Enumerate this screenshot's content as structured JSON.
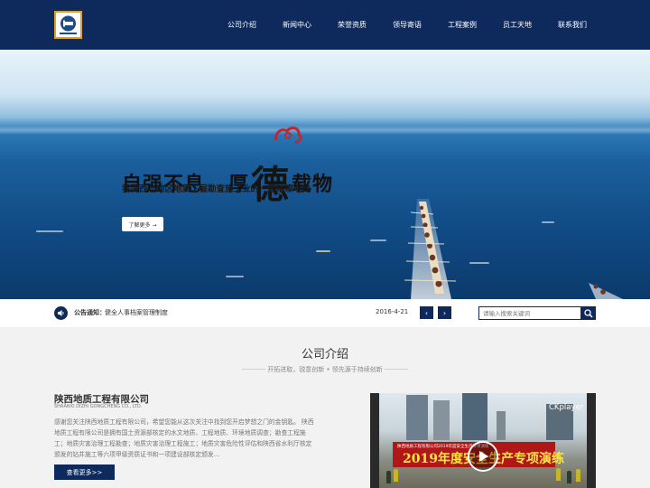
{
  "header": {
    "nav": [
      "公司介绍",
      "新闻中心",
      "荣誉资质",
      "领导寄语",
      "工程案例",
      "员工天地",
      "联系我们"
    ]
  },
  "banner": {
    "title_left": "自强不息",
    "title_mid_a": "厚",
    "title_big": "德",
    "title_right": "载物",
    "subtitle": "我国西北地区地质工程勘查施工业的一颗璀璨明珠",
    "button": "了解更多 →"
  },
  "notice": {
    "label": "公告通知：",
    "text": "健全人事档案管理制度",
    "date": "2016-4-21",
    "prev": "‹",
    "next": "›",
    "search_placeholder": "请输入搜索关键词"
  },
  "about": {
    "title": "公司介绍",
    "subtitle": "开拓进取，锐意创新 • 领先源于持续创新",
    "company_name": "陕西地质工程有限公司",
    "company_en": "SHAANXI DIZHI GONGCHENG CO., LTD.",
    "description": "感谢您关注陕西地质工程有限公司，希望您能从这次关注中找到您开启梦想之门的金钥匙。    陕西地质工程有限公司是拥有国土资源部核定的水文地质、工程地质、环境地质调查；勘查工程施工；地质灾害治理工程勘查；地质灾害治理工程施工；地质灾害危险性评估和陕西省水利厅核定颁发的钻井施工等六项甲级资质证书和一项建设部核定颁发...",
    "more_button": "查看更多>>"
  },
  "video": {
    "player_logo": "CKplayer",
    "caption": "2019年度安全生产专项演练",
    "banner_small": "陕西地质工程有限公司2019年度安全生产专项演练"
  },
  "colors": {
    "navy": "#0e2a5c",
    "sea": "#1b5f9d"
  }
}
